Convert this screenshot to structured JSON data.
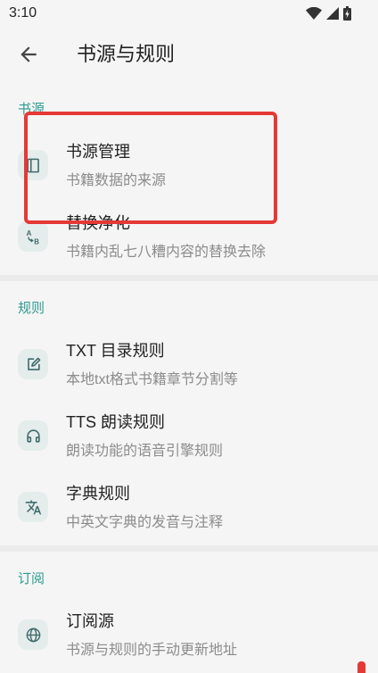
{
  "status_bar": {
    "time": "3:10",
    "icons": [
      "wifi-icon",
      "signal-icon",
      "battery-charging-icon"
    ]
  },
  "app_bar": {
    "back_icon": "arrow-back-icon",
    "title": "书源与规则"
  },
  "sections": [
    {
      "header": "书源",
      "items": [
        {
          "title": "书源管理",
          "subtitle": "书籍数据的来源",
          "icon": "book-icon"
        },
        {
          "title": "替换净化",
          "subtitle": "书籍内乱七八糟内容的替换去除",
          "icon": "replace-icon",
          "icon_glyph": {
            "from": "A",
            "to": "B"
          }
        }
      ]
    },
    {
      "header": "规则",
      "items": [
        {
          "title": "TXT 目录规则",
          "subtitle": "本地txt格式书籍章节分割等",
          "icon": "edit-icon"
        },
        {
          "title": "TTS 朗读规则",
          "subtitle": "朗读功能的语音引擎规则",
          "icon": "headphones-icon"
        },
        {
          "title": "字典规则",
          "subtitle": "中英文字典的发音与注释",
          "icon": "translate-icon"
        }
      ]
    },
    {
      "header": "订阅",
      "items": [
        {
          "title": "订阅源",
          "subtitle": "书源与规则的手动更新地址",
          "icon": "globe-icon"
        }
      ]
    }
  ],
  "colors": {
    "accent": "#2e9b8f",
    "annotation": "#e53935",
    "background": "#f5f5f5",
    "icon_background": "#e5ecec",
    "icon_foreground": "#3f6a6a"
  }
}
